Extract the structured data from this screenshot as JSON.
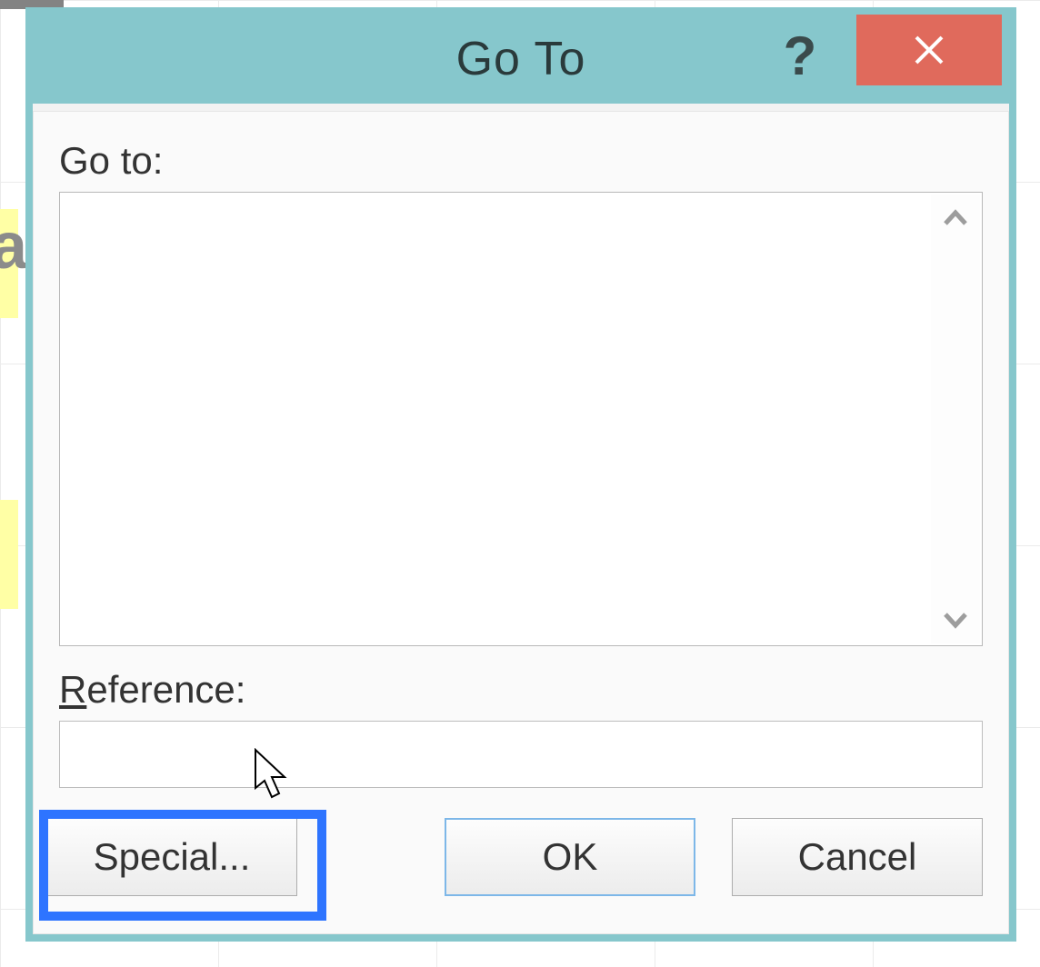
{
  "dialog": {
    "title": "Go To",
    "labels": {
      "goto": "Go to:",
      "reference": "Reference:"
    },
    "reference_value": "",
    "buttons": {
      "special": "Special...",
      "ok": "OK",
      "cancel": "Cancel"
    },
    "icons": {
      "help": "?",
      "close": "close-icon",
      "scroll_up": "chevron-up-icon",
      "scroll_down": "chevron-down-icon"
    }
  },
  "colors": {
    "titlebar": "#86c7cc",
    "close": "#e06a5c",
    "highlight": "#2e74ff"
  }
}
